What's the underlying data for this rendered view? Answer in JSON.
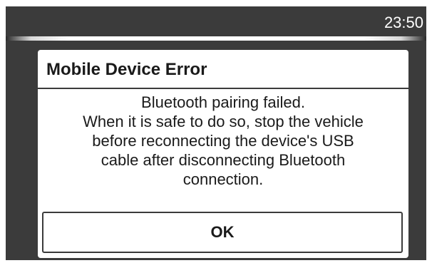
{
  "status_bar": {
    "time": "23:50"
  },
  "dialog": {
    "title": "Mobile Device Error",
    "message_lines": [
      "Bluetooth pairing failed.",
      "When it is safe to do so, stop the vehicle",
      "before reconnecting the device's USB",
      "cable after disconnecting Bluetooth",
      "connection."
    ],
    "ok_label": "OK"
  },
  "colors": {
    "screen_background": "#3b3b3b",
    "dialog_background": "#ffffff",
    "text": "#1a1a1a"
  }
}
